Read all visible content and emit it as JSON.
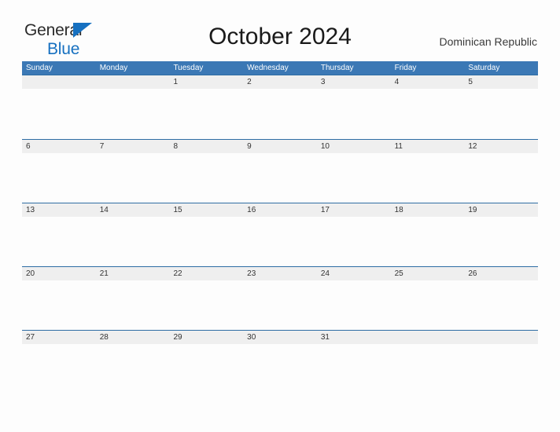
{
  "brand": {
    "logo_line1": "General",
    "logo_line2": "Blue",
    "logo_icon": "triangle-flag-icon",
    "color_dark": "#2b2b2b",
    "color_blue": "#1670c0"
  },
  "header": {
    "title": "October 2024",
    "country": "Dominican Republic"
  },
  "calendar": {
    "accent_color": "#3b78b5",
    "rule_color": "#2e6da4",
    "date_band_color": "#efefef",
    "weekdays": [
      "Sunday",
      "Monday",
      "Tuesday",
      "Wednesday",
      "Thursday",
      "Friday",
      "Saturday"
    ],
    "weeks": [
      {
        "dates": [
          "",
          "",
          "1",
          "2",
          "3",
          "4",
          "5"
        ]
      },
      {
        "dates": [
          "6",
          "7",
          "8",
          "9",
          "10",
          "11",
          "12"
        ]
      },
      {
        "dates": [
          "13",
          "14",
          "15",
          "16",
          "17",
          "18",
          "19"
        ]
      },
      {
        "dates": [
          "20",
          "21",
          "22",
          "23",
          "24",
          "25",
          "26"
        ]
      },
      {
        "dates": [
          "27",
          "28",
          "29",
          "30",
          "31",
          "",
          ""
        ]
      }
    ]
  }
}
